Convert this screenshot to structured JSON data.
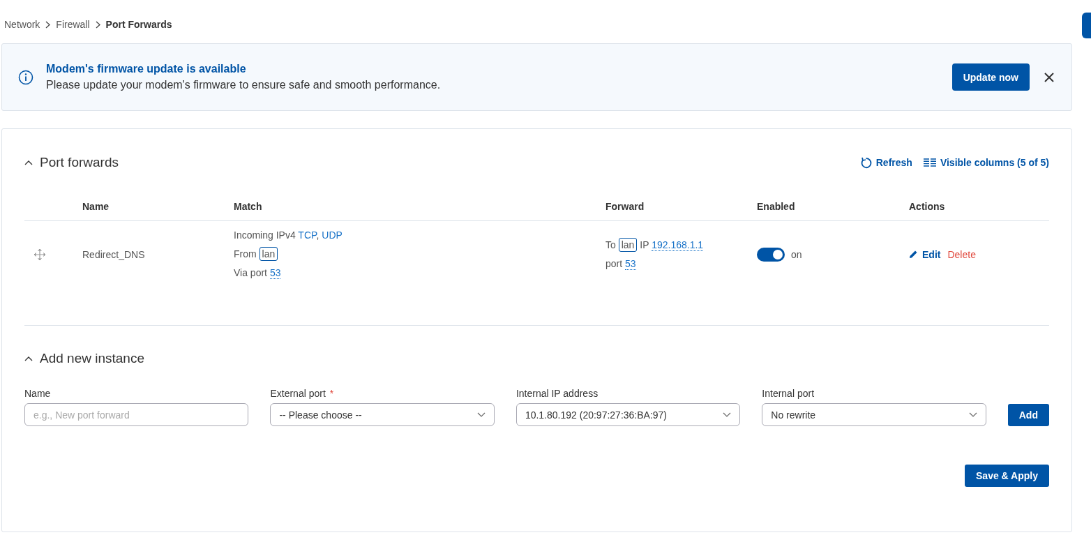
{
  "breadcrumb": [
    {
      "label": "Network",
      "current": false
    },
    {
      "label": "Firewall",
      "current": false
    },
    {
      "label": "Port Forwards",
      "current": true
    }
  ],
  "notice": {
    "title": "Modem's firmware update is available",
    "message": "Please update your modem's firmware to ensure safe and smooth performance.",
    "button": "Update now"
  },
  "port_forwards": {
    "title": "Port forwards",
    "expanded": true,
    "toolbar": [
      {
        "kind": "refresh",
        "label": "Refresh"
      },
      {
        "kind": "columns",
        "label": "Visible columns (5 of 5)"
      }
    ],
    "columns": [
      "Name",
      "Match",
      "Forward",
      "Enabled",
      "Actions"
    ],
    "rows": [
      {
        "name": "Redirect_DNS",
        "match": [
          [
            {
              "kind": "text",
              "text": "Incoming IPv4"
            },
            {
              "kind": "link",
              "text": "TCP"
            },
            {
              "kind": "text",
              "text": ", "
            },
            {
              "kind": "link",
              "text": "UDP"
            }
          ],
          [
            {
              "kind": "text",
              "text": "From"
            },
            {
              "kind": "tag",
              "text": "lan"
            }
          ],
          [
            {
              "kind": "text",
              "text": "Via port"
            },
            {
              "kind": "dotted",
              "text": "53"
            }
          ]
        ],
        "forward": [
          [
            {
              "kind": "text",
              "text": "To"
            },
            {
              "kind": "tag",
              "text": "lan"
            },
            {
              "kind": "text",
              "text": "IP"
            },
            {
              "kind": "dotted",
              "text": "192.168.1.1"
            }
          ],
          [
            {
              "kind": "text",
              "text": "port"
            },
            {
              "kind": "dotted",
              "text": "53"
            }
          ]
        ],
        "enabled": true,
        "enabled_label": "on",
        "actions": [
          {
            "kind": "edit",
            "label": "Edit"
          },
          {
            "kind": "delete",
            "label": "Delete"
          }
        ]
      }
    ]
  },
  "add_instance": {
    "title": "Add new instance",
    "expanded": true,
    "fields": [
      {
        "kind": "input",
        "label": "Name",
        "required": false,
        "placeholder": "e.g., New port forward"
      },
      {
        "kind": "select",
        "label": "External port",
        "required": true,
        "value": "-- Please choose --"
      },
      {
        "kind": "select",
        "label": "Internal IP address",
        "required": false,
        "value": "10.1.80.192 (20:97:27:36:BA:97)"
      },
      {
        "kind": "select",
        "label": "Internal port",
        "required": false,
        "value": "No rewrite"
      }
    ],
    "required_mark": "*",
    "add_button": "Add",
    "save_button": "Save & Apply"
  }
}
